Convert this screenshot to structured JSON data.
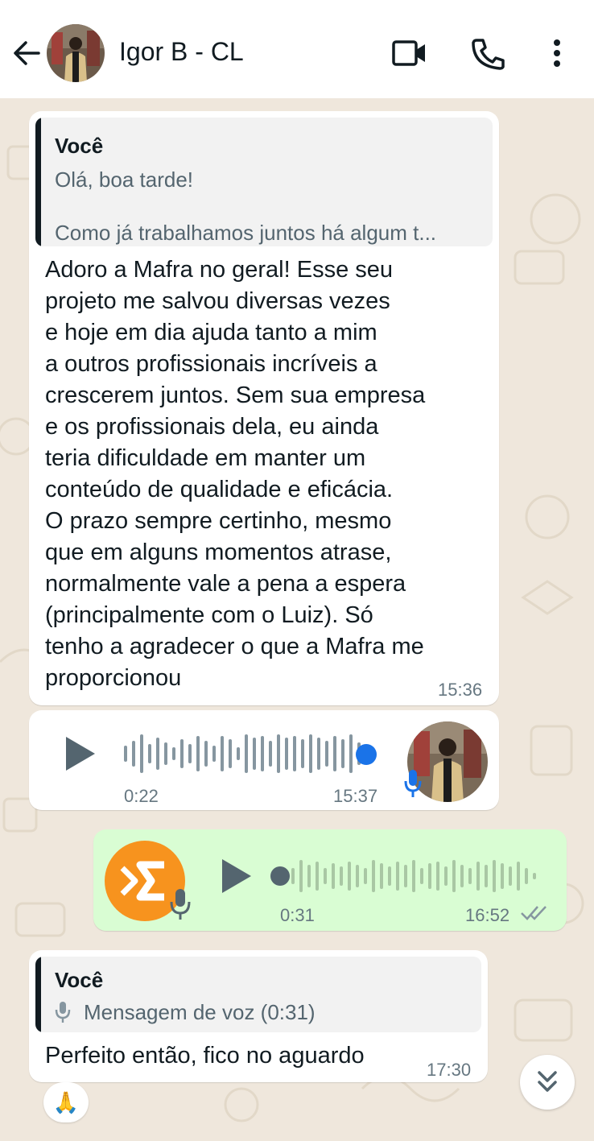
{
  "header": {
    "contact_name": "Igor B - CL"
  },
  "messages": [
    {
      "type": "text-with-quote",
      "direction": "in",
      "quote_author": "Você",
      "quote_line1": "Olá, boa tarde!",
      "quote_line2": "Como já trabalhamos juntos há algum t...",
      "text": "Adoro a Mafra no geral! Esse seu\nprojeto me salvou diversas vezes\ne hoje em dia ajuda tanto a mim\na outros profissionais incríveis a\ncrescerem juntos. Sem sua empresa\ne os profissionais dela, eu ainda\nteria dificuldade em manter um\nconteúdo de qualidade e eficácia.\nO prazo sempre certinho, mesmo\nque em alguns momentos atrase,\nnormalmente vale a pena a espera\n(principalmente com o Luiz). Só\ntenho a agradecer o que a Mafra me\nproporcionou",
      "time": "15:36"
    },
    {
      "type": "voice",
      "direction": "in",
      "duration": "0:22",
      "time": "15:37",
      "progress": 0.98
    },
    {
      "type": "voice",
      "direction": "out",
      "duration": "0:31",
      "time": "16:52",
      "progress": 0.0,
      "status": "read"
    },
    {
      "type": "text-with-quote",
      "direction": "in",
      "quote_author": "Você",
      "quote_voice": "Mensagem de voz (0:31)",
      "text": "Perfeito então, fico no aguardo",
      "time": "17:30",
      "reaction": "🙏"
    }
  ],
  "colors": {
    "incoming_bubble": "#ffffff",
    "outgoing_bubble": "#d9fdd3",
    "accent_blue": "#1a73e8",
    "chat_background": "#efe7dc",
    "brand_orange": "#f7931e"
  }
}
